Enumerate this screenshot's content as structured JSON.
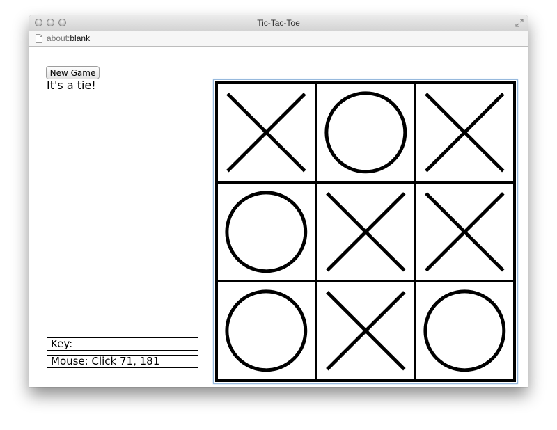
{
  "window": {
    "title": "Tic-Tac-Toe"
  },
  "urlbar": {
    "scheme": "about:",
    "rest": "blank"
  },
  "controls": {
    "new_game_label": "New Game",
    "status_text": "It's a tie!"
  },
  "info": {
    "key_text": "Key:",
    "mouse_text": "Mouse: Click 71, 181"
  },
  "board": {
    "cells": [
      "X",
      "O",
      "X",
      "O",
      "X",
      "X",
      "O",
      "X",
      "O"
    ]
  },
  "icons": {
    "x_mark": "x-mark-icon",
    "o_mark": "o-mark-icon",
    "document": "document-icon",
    "resize": "fullscreen-icon"
  }
}
